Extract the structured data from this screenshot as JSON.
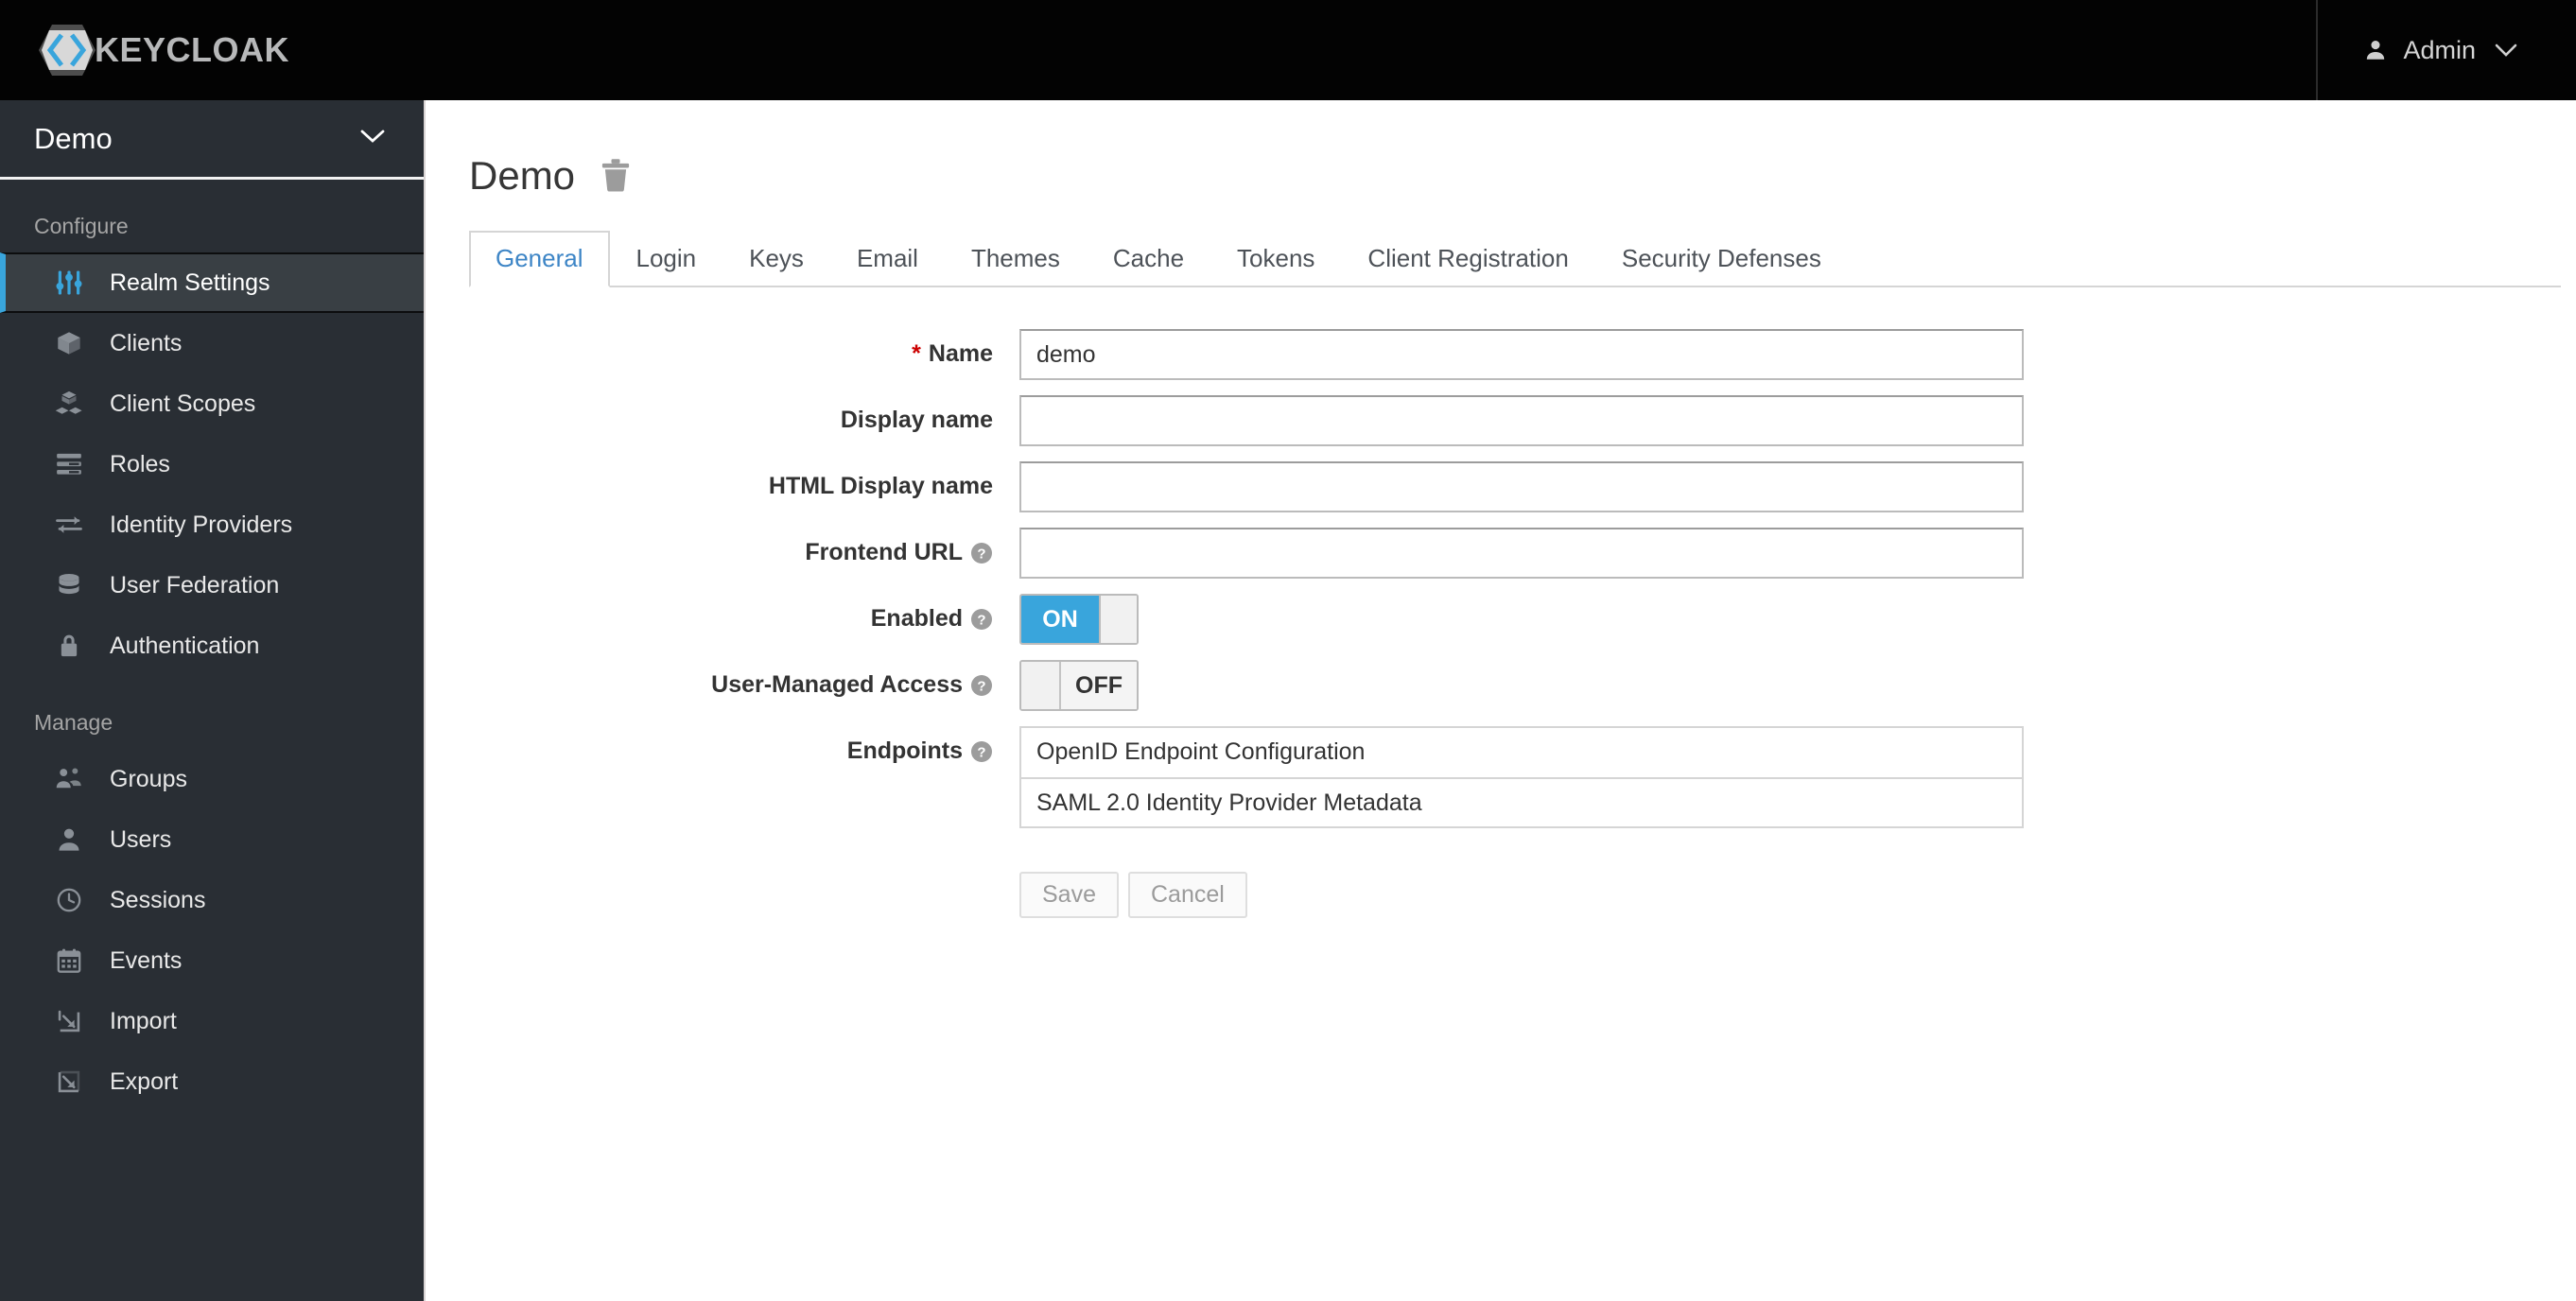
{
  "masthead": {
    "brand_name": "KEYCLOAK",
    "brand_icon": "keycloak-logo-icon",
    "user_icon": "user-icon",
    "user_name": "Admin",
    "caret_icon": "chevron-down-icon"
  },
  "sidebar": {
    "realm": {
      "name": "Demo",
      "caret_icon": "chevron-down-icon"
    },
    "groups": [
      {
        "label": "Configure",
        "items": [
          {
            "label": "Realm Settings",
            "icon": "sliders-icon",
            "active": true
          },
          {
            "label": "Clients",
            "icon": "cube-icon",
            "active": false
          },
          {
            "label": "Client Scopes",
            "icon": "cubes-icon",
            "active": false
          },
          {
            "label": "Roles",
            "icon": "list-bars-icon",
            "active": false
          },
          {
            "label": "Identity Providers",
            "icon": "exchange-arrows-icon",
            "active": false
          },
          {
            "label": "User Federation",
            "icon": "database-icon",
            "active": false
          },
          {
            "label": "Authentication",
            "icon": "lock-icon",
            "active": false
          }
        ]
      },
      {
        "label": "Manage",
        "items": [
          {
            "label": "Groups",
            "icon": "users-group-icon",
            "active": false
          },
          {
            "label": "Users",
            "icon": "user-icon",
            "active": false
          },
          {
            "label": "Sessions",
            "icon": "clock-icon",
            "active": false
          },
          {
            "label": "Events",
            "icon": "calendar-icon",
            "active": false
          },
          {
            "label": "Import",
            "icon": "import-arrow-icon",
            "active": false
          },
          {
            "label": "Export",
            "icon": "export-arrow-icon",
            "active": false
          }
        ]
      }
    ]
  },
  "main": {
    "page_title": "Demo",
    "delete_icon": "trash-icon",
    "tabs": [
      {
        "label": "General",
        "active": true
      },
      {
        "label": "Login",
        "active": false
      },
      {
        "label": "Keys",
        "active": false
      },
      {
        "label": "Email",
        "active": false
      },
      {
        "label": "Themes",
        "active": false
      },
      {
        "label": "Cache",
        "active": false
      },
      {
        "label": "Tokens",
        "active": false
      },
      {
        "label": "Client Registration",
        "active": false
      },
      {
        "label": "Security Defenses",
        "active": false
      }
    ],
    "form": {
      "name": {
        "label": "Name",
        "value": "demo",
        "required": true,
        "required_marker": "*"
      },
      "display_name": {
        "label": "Display name",
        "value": ""
      },
      "html_display_name": {
        "label": "HTML Display name",
        "value": ""
      },
      "frontend_url": {
        "label": "Frontend URL",
        "value": "",
        "help_icon": "help-circle-icon"
      },
      "enabled": {
        "label": "Enabled",
        "state": "ON",
        "help_icon": "help-circle-icon"
      },
      "user_managed_access": {
        "label": "User-Managed Access",
        "state": "OFF",
        "help_icon": "help-circle-icon"
      },
      "endpoints": {
        "label": "Endpoints",
        "help_icon": "help-circle-icon",
        "items": [
          "OpenID Endpoint Configuration",
          "SAML 2.0 Identity Provider Metadata"
        ]
      },
      "save_label": "Save",
      "cancel_label": "Cancel"
    }
  },
  "colors": {
    "masthead_bg": "#030303",
    "sidebar_bg": "#292e34",
    "sidebar_active_bg": "#393f44",
    "accent_blue": "#39a5dc",
    "tab_active_text": "#3d85c6",
    "required_red": "#cc0000"
  }
}
